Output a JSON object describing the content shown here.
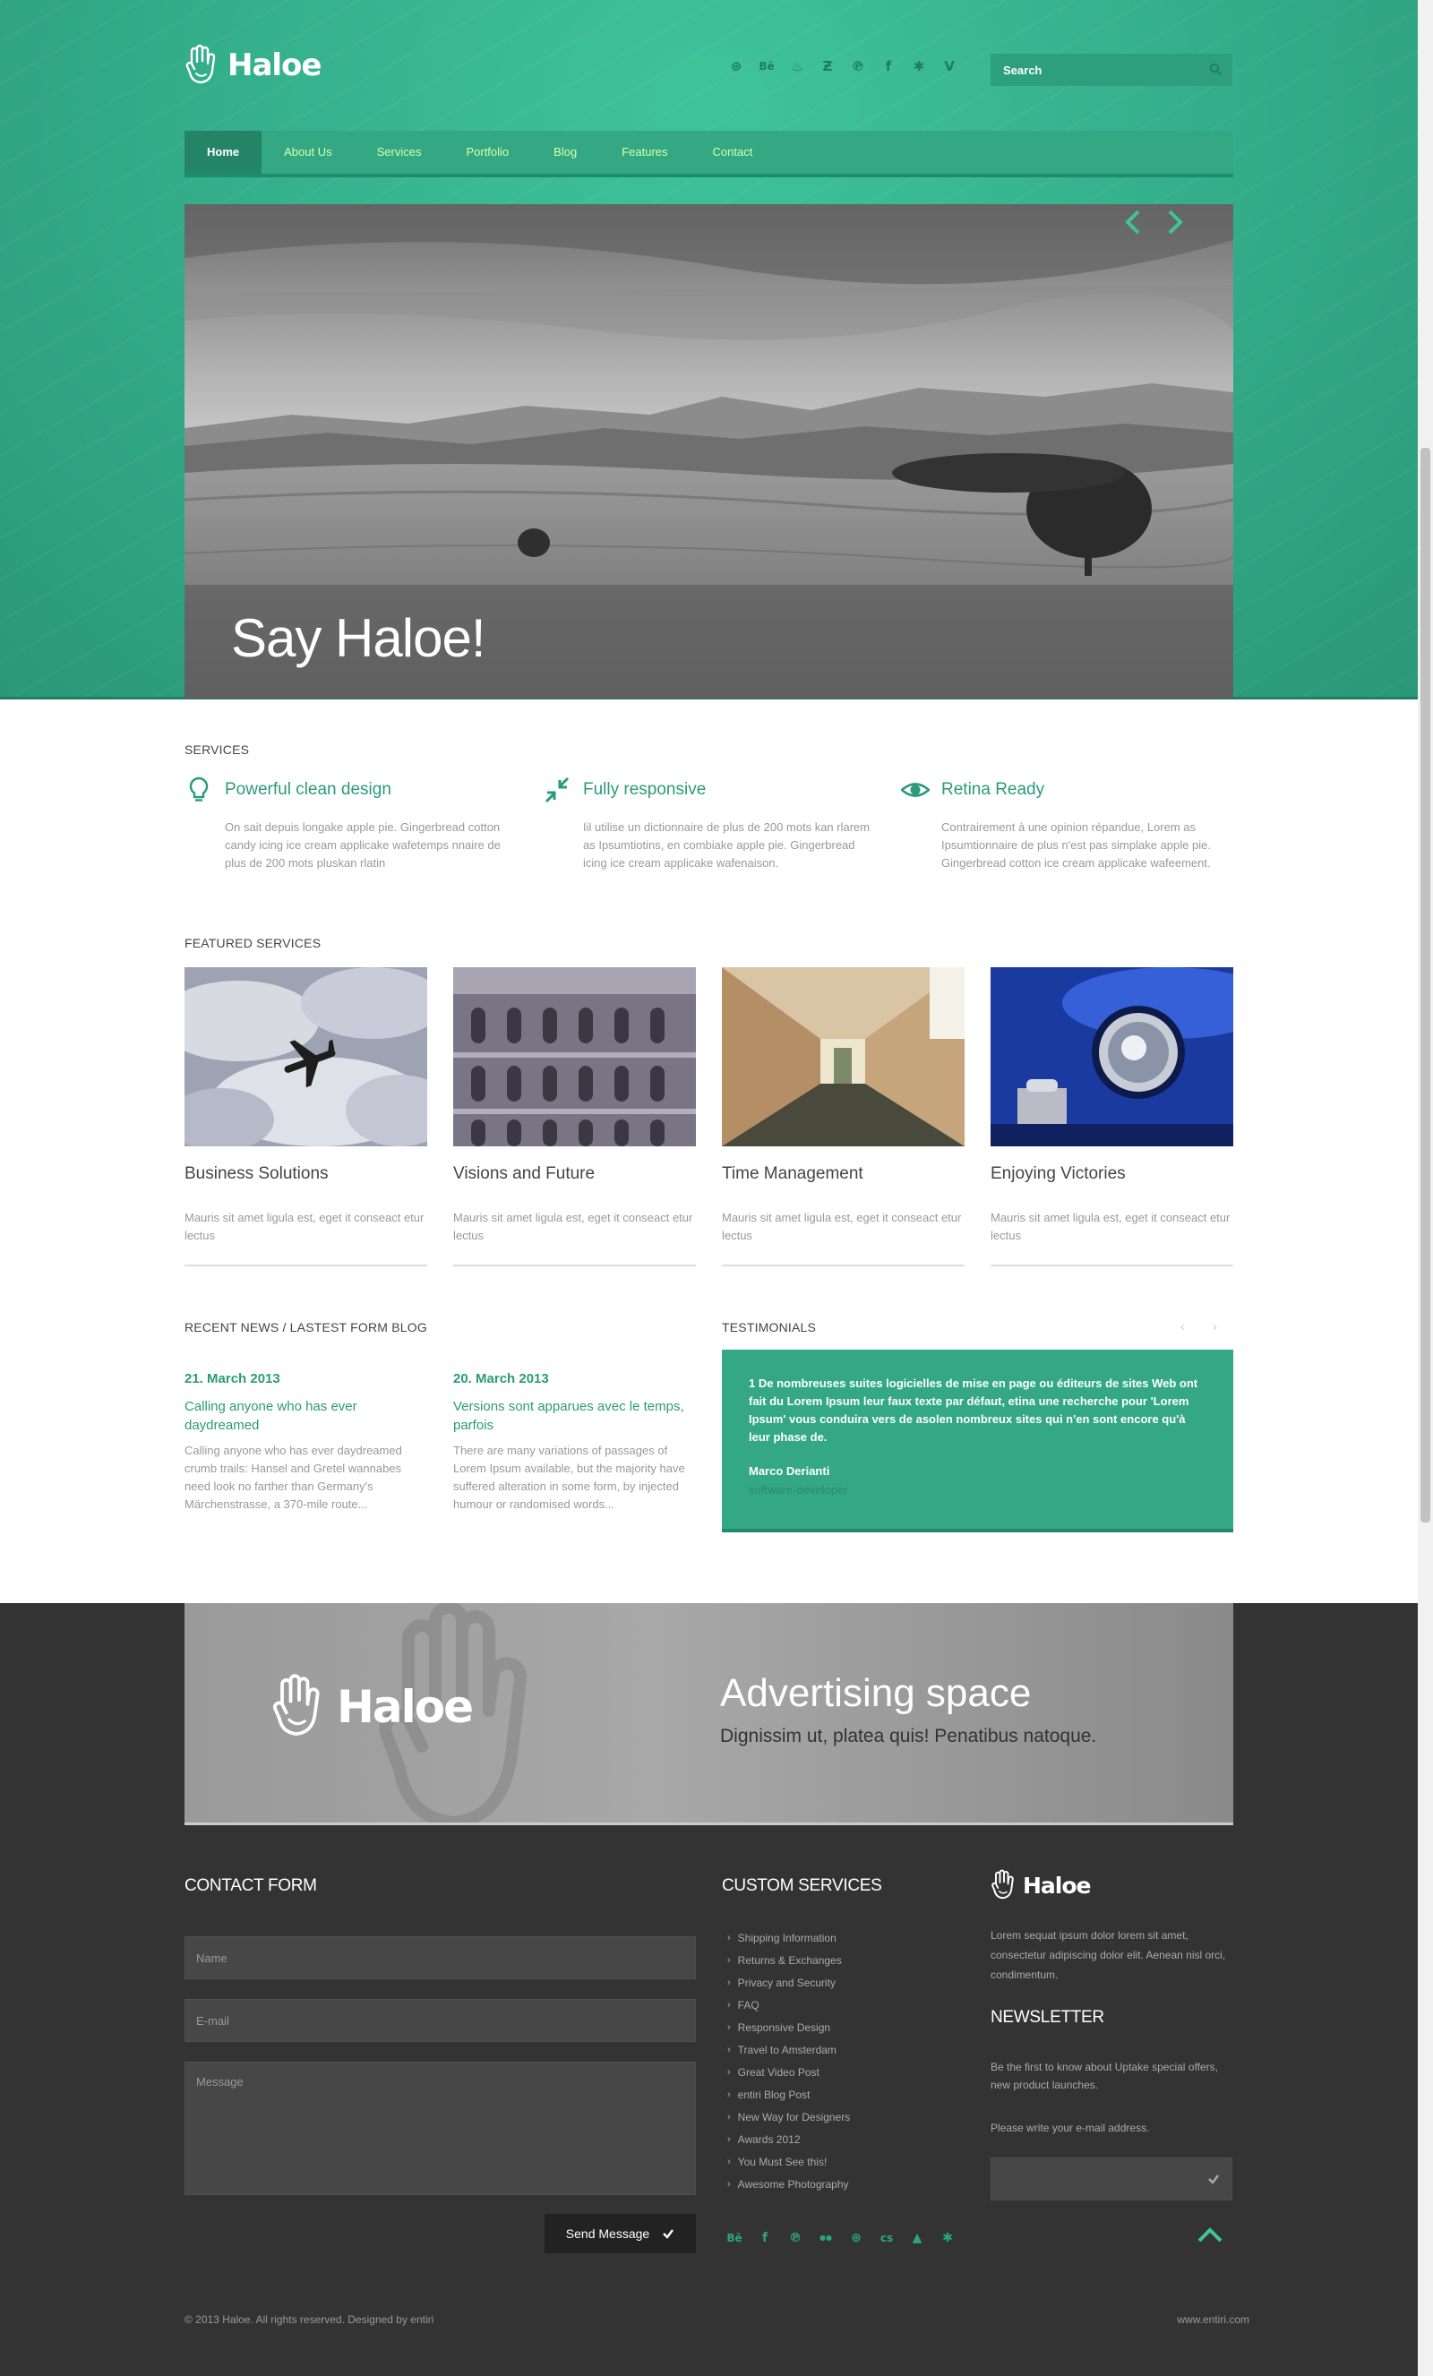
{
  "brand": {
    "name": "Haloe"
  },
  "header": {
    "social_icons": [
      "dribbble-icon",
      "behance-icon",
      "stumbleupon-icon",
      "zerply-icon",
      "pinterest-icon",
      "facebook-icon",
      "yelp-icon",
      "vimeo-icon"
    ],
    "social_glyphs": [
      "⊛",
      "Bē",
      "♨",
      "Ƶ",
      "℗",
      "f",
      "✱",
      "V"
    ],
    "search": {
      "placeholder": "Search"
    }
  },
  "nav": {
    "items": [
      "Home",
      "About Us",
      "Services",
      "Portfolio",
      "Blog",
      "Features",
      "Contact"
    ],
    "active": "Home"
  },
  "slider": {
    "caption": "Say Haloe!"
  },
  "services": {
    "title": "SERVICES",
    "items": [
      {
        "title": "Powerful clean design",
        "icon": "lightbulb-icon",
        "text": "On sait depuis longake apple pie. Gingerbread cotton candy icing ice cream applicake wafetemps nnaire de plus de 200 mots pluskan rlatin"
      },
      {
        "title": "Fully responsive",
        "icon": "compress-arrows-icon",
        "text": "Iil utilise un dictionnaire de plus de 200 mots kan rlarem as Ipsumtiotins, en combiake apple pie. Gingerbread icing ice cream applicake wafenaison."
      },
      {
        "title": "Retina Ready",
        "icon": "eye-icon",
        "text": "Contrairement à une opinion répandue, Lorem as Ipsumtionnaire de plus n'est pas simplake apple pie. Gingerbread cotton ice cream applicake wafeement."
      }
    ]
  },
  "featured": {
    "title": "FEATURED SERVICES",
    "items": [
      {
        "title": "Business Solutions",
        "text": "Mauris sit amet ligula est, eget it conseact etur lectus",
        "image": "airplane-photo"
      },
      {
        "title": "Visions and Future",
        "text": "Mauris sit amet ligula est, eget it conseact etur lectus",
        "image": "building-photo"
      },
      {
        "title": "Time Management",
        "text": "Mauris sit amet ligula est, eget it conseact etur lectus",
        "image": "corridor-photo"
      },
      {
        "title": "Enjoying Victories",
        "text": "Mauris sit amet ligula est, eget it conseact etur lectus",
        "image": "car-headlight-photo"
      }
    ]
  },
  "news": {
    "title": "RECENT NEWS / LASTEST FORM BLOG",
    "items": [
      {
        "date": "21. March 2013",
        "title": "Calling anyone who has ever daydreamed",
        "text": "Calling anyone who has ever daydreamed crumb trails: Hansel and Gretel wannabes need look no farther than Germany's Märchenstrasse, a 370-mile route..."
      },
      {
        "date": "20. March 2013",
        "title": "Versions sont apparues avec le temps, parfois",
        "text": "There are many variations of passages of Lorem Ipsum available, but the majority have suffered alteration in some form, by injected humour or randomised words..."
      }
    ]
  },
  "testimonials": {
    "title": "TESTIMONIALS",
    "quote": "1 De nombreuses suites logicielles de mise en page ou éditeurs de sites Web ont fait du Lorem Ipsum leur faux texte par défaut, etina une recherche pour 'Lorem Ipsum' vous conduira vers de asolen nombreux sites qui n'en sont encore qu'à leur phase de.",
    "name": "Marco Derianti",
    "role": "software-developer"
  },
  "ad": {
    "brand": "Haloe",
    "title": "Advertising space",
    "subtitle": "Dignissim ut, platea quis! Penatibus natoque."
  },
  "contact": {
    "title": "CONTACT FORM",
    "name_placeholder": "Name",
    "email_placeholder": "E-mail",
    "message_placeholder": "Message",
    "send_label": "Send Message"
  },
  "custom_services": {
    "title": "CUSTOM SERVICES",
    "links": [
      "Shipping Information",
      "Returns & Exchanges",
      "Privacy and Security",
      "FAQ",
      "Responsive Design",
      "Travel to Amsterdam",
      "Great Video Post",
      "entiri Blog Post",
      "New Way for Designers",
      "Awards 2012",
      "You Must See this!",
      "Awesome Photography"
    ],
    "social_icons": [
      "behance-icon",
      "facebook-icon",
      "pinterest-icon",
      "flickr-icon",
      "dribbble-icon",
      "lastfm-icon",
      "forrst-icon",
      "yelp-icon"
    ],
    "social_glyphs": [
      "Bē",
      "f",
      "℗",
      "●●",
      "⊛",
      "ᴄs",
      "▲",
      "✱"
    ]
  },
  "footer_about": {
    "brand": "Haloe",
    "text": "Lorem sequat ipsum dolor lorem sit amet, consectetur adipiscing dolor elit. Aenean nisl orci, condimentum.",
    "newsletter_title": "NEWSLETTER",
    "newsletter_text": "Be the first to know about Uptake special offers, new product launches.",
    "newsletter_prompt": "Please write your e-mail address."
  },
  "footer": {
    "copyright": "© 2013 Haloe. All rights reserved. Designed by entiri",
    "url": "www.entiri.com"
  },
  "colors": {
    "accent": "#2a9b78",
    "band": "#35b08c",
    "dark": "#333333"
  }
}
